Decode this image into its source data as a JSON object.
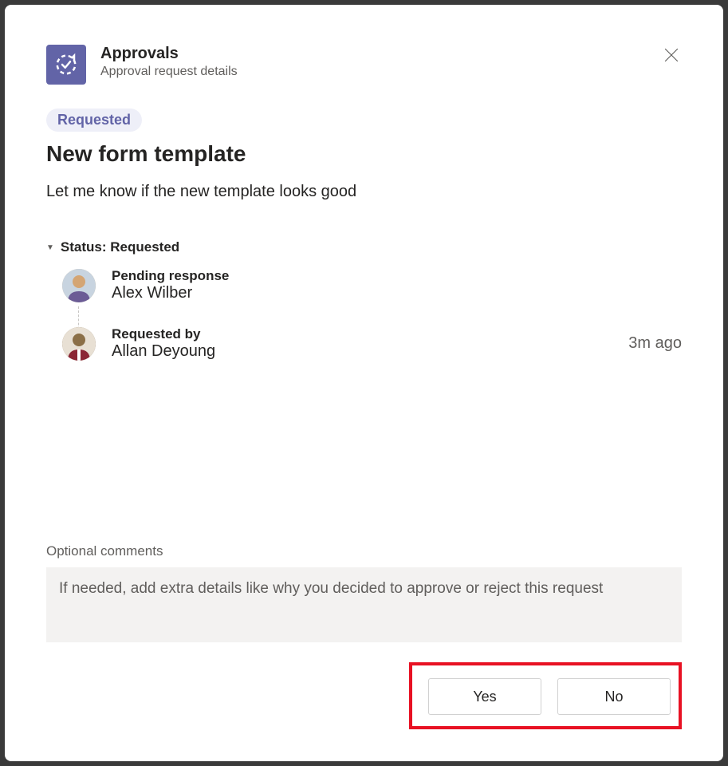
{
  "header": {
    "appTitle": "Approvals",
    "appSubtitle": "Approval request details"
  },
  "statusBadge": "Requested",
  "request": {
    "title": "New form template",
    "description": "Let me know if the new template looks good"
  },
  "statusSection": {
    "label": "Status: Requested",
    "participants": [
      {
        "label": "Pending response",
        "name": "Alex Wilber",
        "timestamp": ""
      },
      {
        "label": "Requested by",
        "name": "Allan Deyoung",
        "timestamp": "3m ago"
      }
    ]
  },
  "comments": {
    "label": "Optional comments",
    "placeholder": "If needed, add extra details like why you decided to approve or reject this request"
  },
  "actions": {
    "yes": "Yes",
    "no": "No"
  }
}
